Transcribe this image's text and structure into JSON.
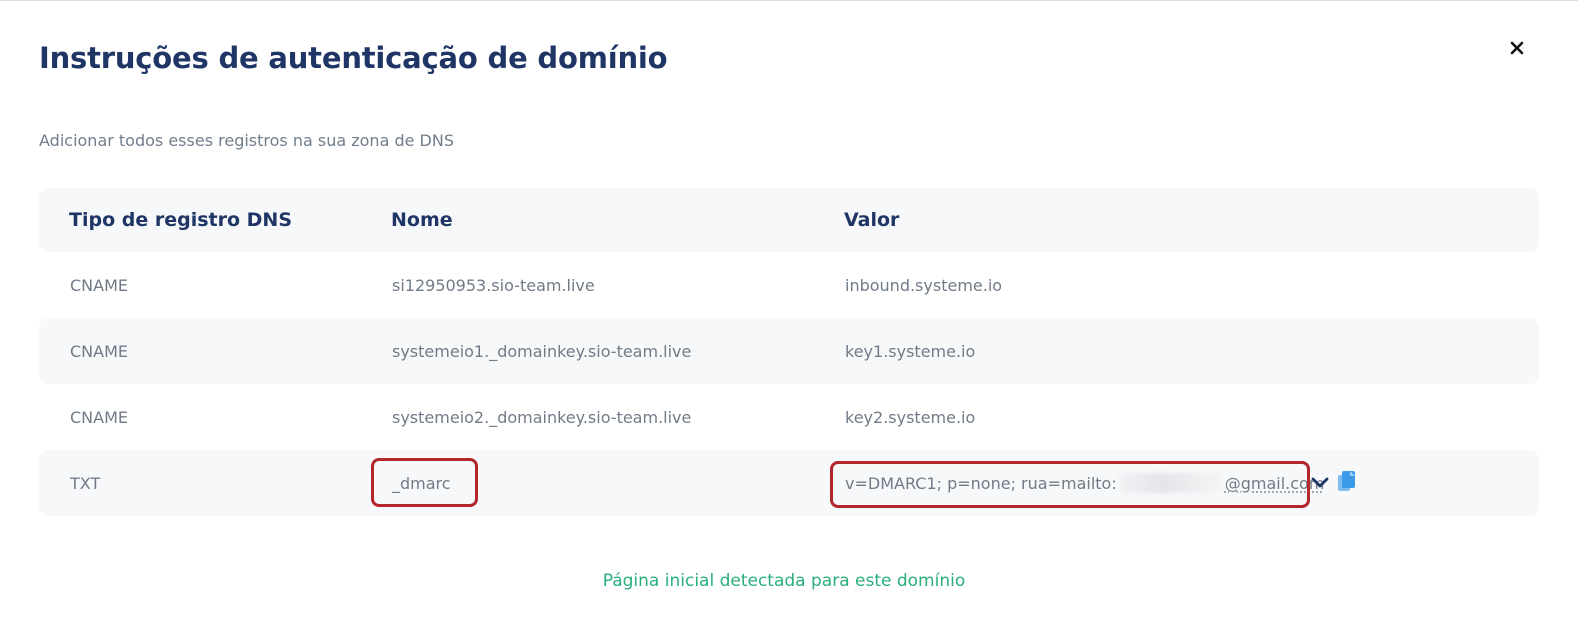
{
  "modal": {
    "title": "Instruções de autenticação de domínio",
    "subtitle": "Adicionar todos esses registros na sua zona de DNS",
    "close_icon": "close-icon"
  },
  "table": {
    "headers": [
      "Tipo de registro DNS",
      "Nome",
      "Valor"
    ],
    "rows": [
      {
        "type": "CNAME",
        "name": "si12950953.sio-team.live",
        "value": "inbound.systeme.io"
      },
      {
        "type": "CNAME",
        "name": "systemeio1._domainkey.sio-team.live",
        "value": "key1.systeme.io"
      },
      {
        "type": "CNAME",
        "name": "systemeio2._domainkey.sio-team.live",
        "value": "key2.systeme.io"
      },
      {
        "type": "TXT",
        "name": "_dmarc",
        "value_prefix": "v=DMARC1; p=none; rua=mailto:",
        "value_suffix": "@gmail.com"
      }
    ]
  },
  "icons": {
    "expand": "chevron-down-icon",
    "copy": "copy-icon"
  },
  "footer": {
    "detected_text": "Página inicial detectada para este domínio"
  },
  "colors": {
    "title": "#1f3565",
    "highlight": "#b3262c",
    "success": "#2aae7b",
    "copy_icon": "#3b9be8"
  }
}
